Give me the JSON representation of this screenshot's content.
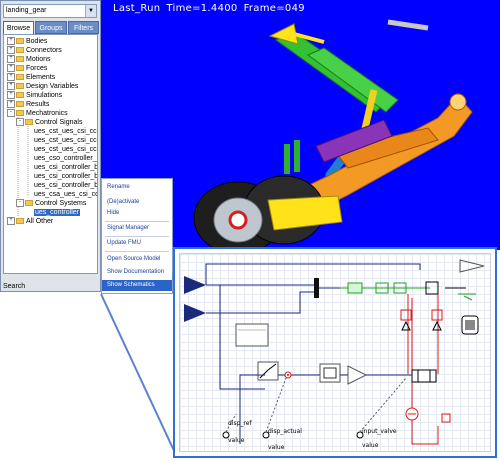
{
  "viewport": {
    "title_name": "Last_Run",
    "time_label": "Time=",
    "time_value": "1.4400",
    "frame_label": "Frame=",
    "frame_value": "049",
    "background_color": "#0000ff"
  },
  "browser": {
    "model_select": "landing_gear",
    "tabs": [
      {
        "label": "Browse",
        "active": true
      },
      {
        "label": "Groups",
        "active": false
      },
      {
        "label": "Filters",
        "active": false
      }
    ],
    "tree": [
      {
        "label": "Bodies",
        "expander": "+"
      },
      {
        "label": "Connectors",
        "expander": "+"
      },
      {
        "label": "Motions",
        "expander": "+"
      },
      {
        "label": "Forces",
        "expander": "+"
      },
      {
        "label": "Elements",
        "expander": "+"
      },
      {
        "label": "Design Variables",
        "expander": "+"
      },
      {
        "label": "Simulations",
        "expander": "+"
      },
      {
        "label": "Results",
        "expander": "+"
      },
      {
        "label": "Mechatronics",
        "expander": "-"
      },
      {
        "label": "Control Signals",
        "expander": "-"
      },
      {
        "label": "ues_cst_ues_csi_cc"
      },
      {
        "label": "ues_cst_ues_csi_cc"
      },
      {
        "label": "ues_cst_ues_csi_cc"
      },
      {
        "label": "ues_cso_controller_"
      },
      {
        "label": "ues_csi_controller_b"
      },
      {
        "label": "ues_csi_controller_b"
      },
      {
        "label": "ues_csi_controller_b"
      },
      {
        "label": "ues_csa_ues_csi_cc"
      },
      {
        "label": "Control Systems",
        "expander": "-"
      },
      {
        "label": "ues_controller",
        "selected": true
      },
      {
        "label": "All Other",
        "expander": "+"
      }
    ],
    "search_label": "Search"
  },
  "context_menu": {
    "items": [
      {
        "label": "Rename"
      },
      {
        "label": "(De)activate"
      },
      {
        "label": "Hide"
      },
      {
        "label": "Signal Manager"
      },
      {
        "label": "Update FMU"
      },
      {
        "label": "Open Source Model"
      },
      {
        "label": "Show Documentation"
      },
      {
        "label": "Show Schematics",
        "highlighted": true
      }
    ]
  },
  "schematic": {
    "labels": {
      "disp_ref": "disp_ref",
      "disp_actual": "disp_actual",
      "input_valve": "input_valve",
      "value1": "value",
      "value2": "value",
      "value3": "value"
    }
  },
  "colors": {
    "accent": "#2f6fd6",
    "selection": "#316ac5",
    "hydraulic_red": "#e01818",
    "signal_navy": "#1a2a7a"
  }
}
